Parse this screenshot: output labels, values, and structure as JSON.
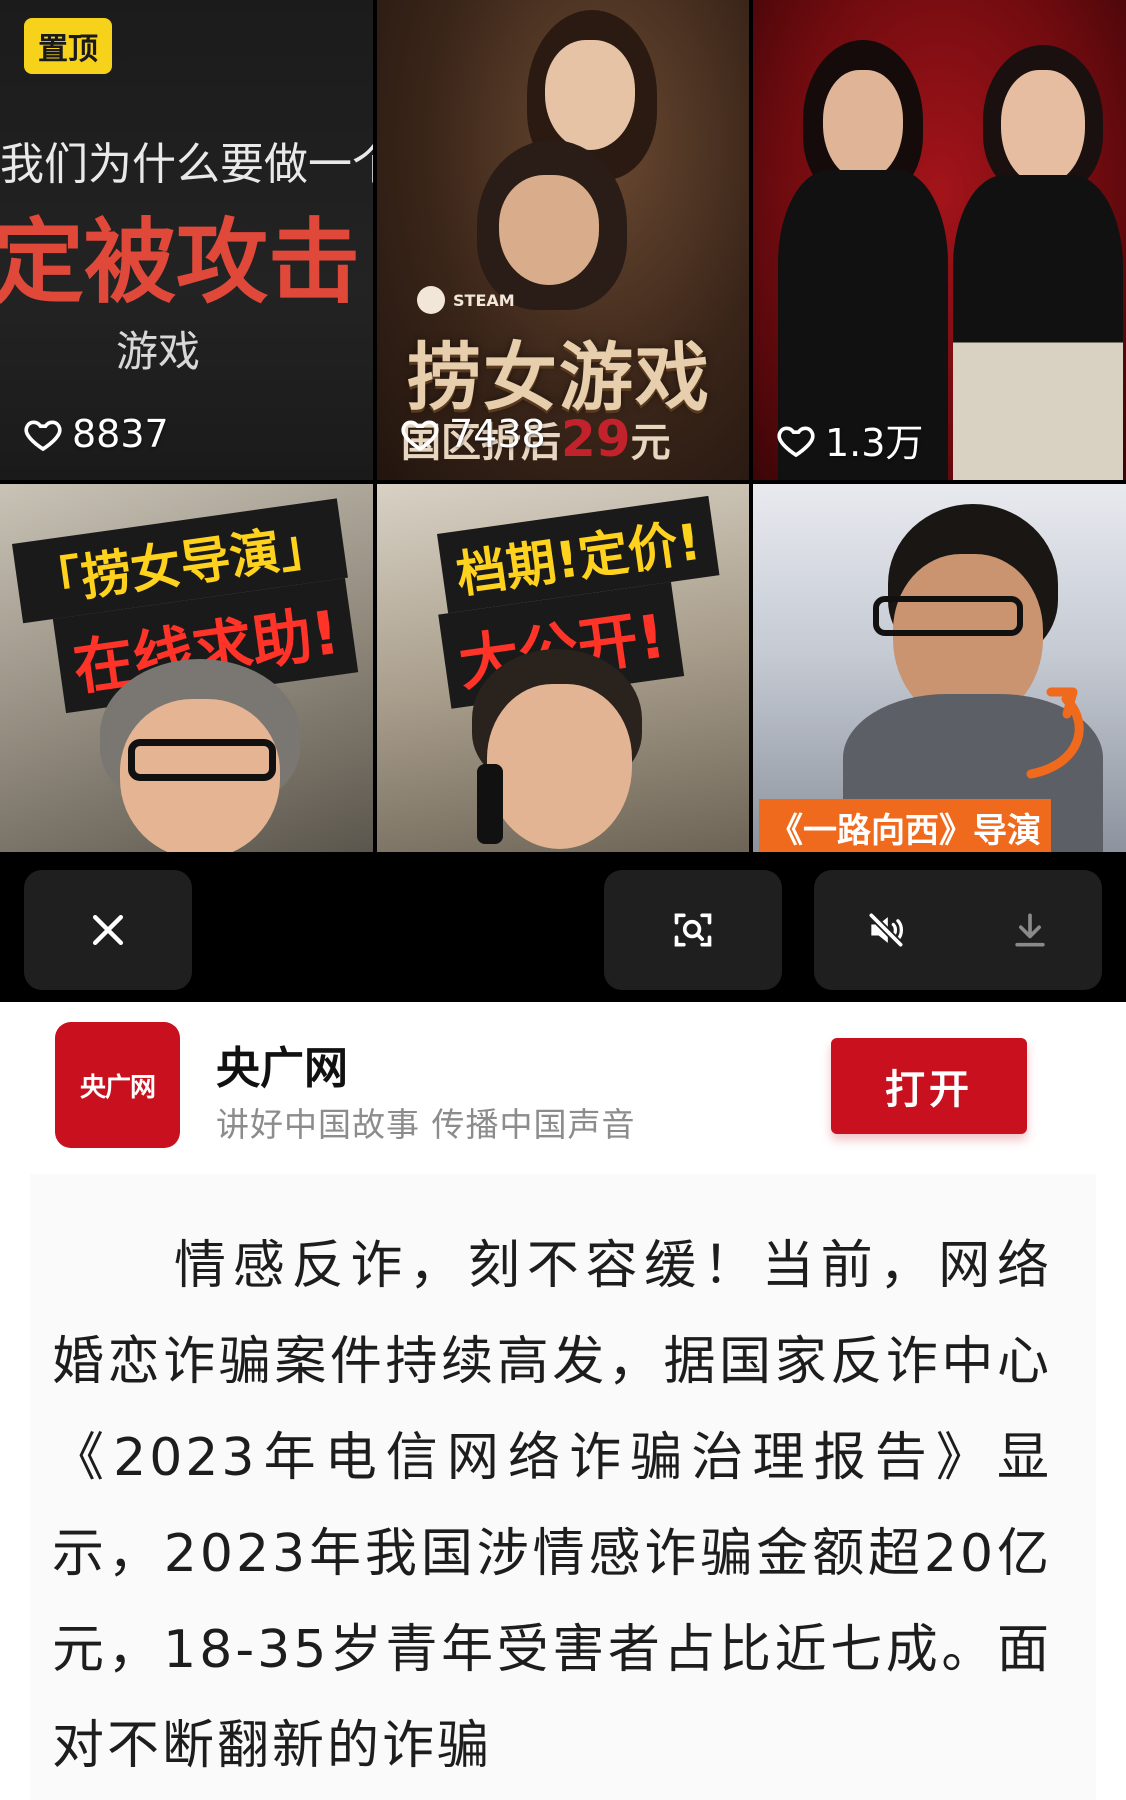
{
  "feed": {
    "tiles": [
      {
        "pin_label": "置顶",
        "headline_1": "我们为什么要做一个",
        "headline_2": "定被攻击",
        "headline_3": "游戏",
        "likes": "8837"
      },
      {
        "badge": "STEAM",
        "title": "捞女游戏",
        "subtitle_prefix": "国区折后",
        "subtitle_price": "29",
        "subtitle_unit": "元",
        "likes": "7438"
      },
      {
        "likes": "1.3万"
      },
      {
        "headline_1": "「捞女导演」",
        "headline_2": "在线求助!"
      },
      {
        "headline_1": "档期!定价!",
        "headline_2": "大公开!"
      },
      {
        "caption": "《一路向西》导演"
      }
    ]
  },
  "colors": {
    "accent": "#c8101e",
    "pin_yellow": "#f7d21b",
    "control_button": "#1f1f1f",
    "caption_orange": "#ef6a1c"
  },
  "controls": {
    "close_icon": "close-icon",
    "lens_icon": "lens-icon",
    "mute_icon": "mute-icon",
    "download_icon": "download-icon"
  },
  "app": {
    "logo_text": "央广网",
    "name": "央广网",
    "slogan": "讲好中国故事 传播中国声音",
    "open_label": "打开"
  },
  "article": {
    "paragraph": "情感反诈，刻不容缓！当前，网络婚恋诈骗案件持续高发，据国家反诈中心《2023年电信网络诈骗治理报告》显示，2023年我国涉情感诈骗金额超20亿元，18-35岁青年受害者占比近七成。面对不断翻新的诈骗"
  }
}
